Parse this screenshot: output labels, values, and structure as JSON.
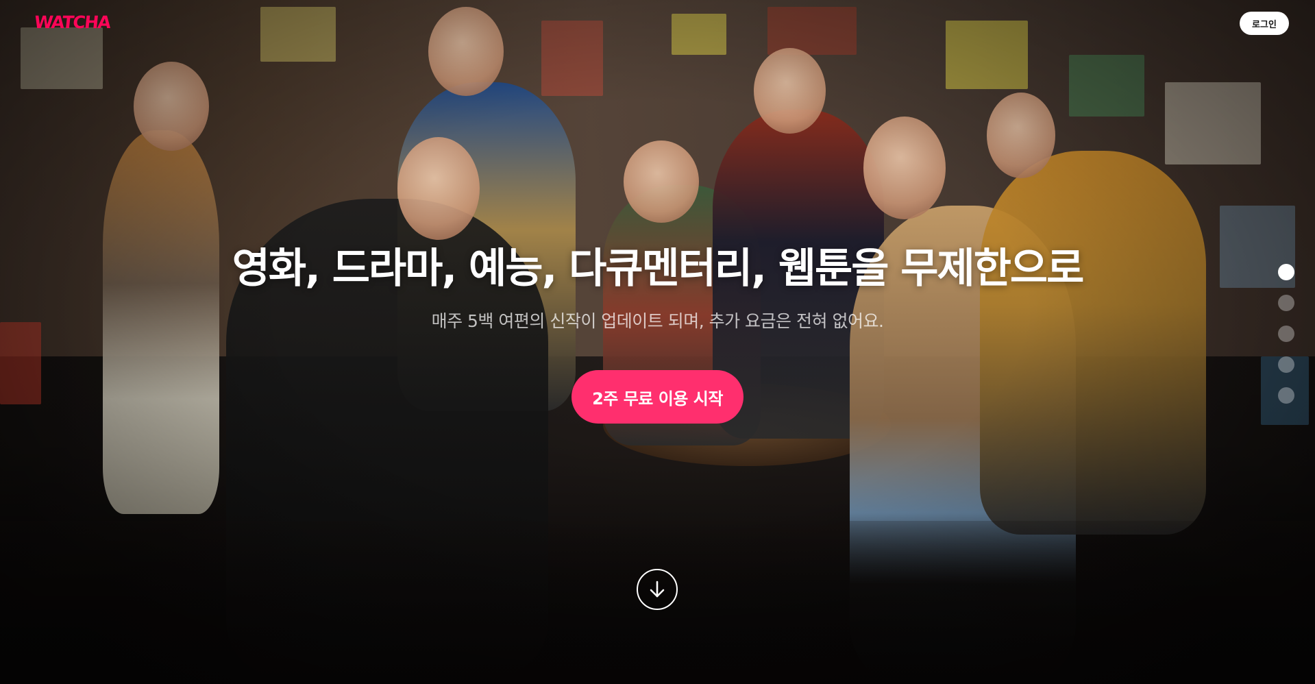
{
  "header": {
    "logo_text": "WATCHA",
    "login_label": "로그인"
  },
  "hero": {
    "title": "영화, 드라마, 예능, 다큐멘터리, 웹툰을 무제한으로",
    "subtitle": "매주 5백 여편의 신작이 업데이트 되며, 추가 요금은 전혀 없어요.",
    "cta_label": "2주 무료 이용 시작"
  },
  "scroll_indicator": {
    "icon": "arrow-down-icon"
  },
  "pagination": {
    "total": 5,
    "active_index": 0
  },
  "colors": {
    "brand": "#ff0558",
    "cta": "#ff2f6e",
    "login_bg": "#ffffff",
    "text": "#ffffff"
  }
}
